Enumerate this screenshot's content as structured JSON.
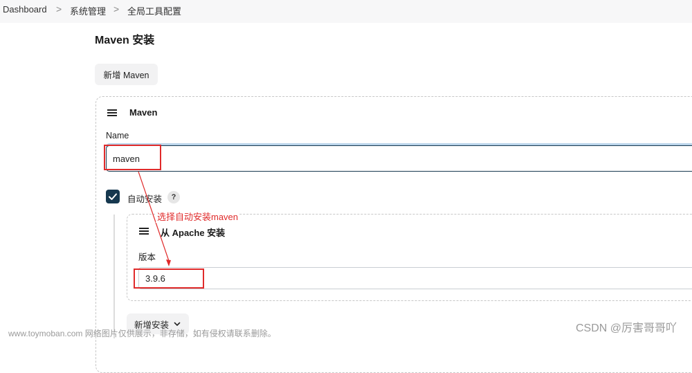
{
  "breadcrumb": {
    "items": [
      "Dashboard",
      "系统管理",
      "全局工具配置"
    ],
    "separator": ">"
  },
  "page_title": "Maven 安装",
  "add_maven_button": "新增 Maven",
  "maven_section": {
    "title": "Maven",
    "name_label": "Name",
    "name_value": "maven"
  },
  "auto_install": {
    "label": "自动安装",
    "checked": true,
    "help": "?"
  },
  "installer": {
    "title": "从 Apache 安装",
    "version_label": "版本",
    "version_value": "3.9.6"
  },
  "add_installer_button": "新增安装",
  "annotation_text": "选择自动安装maven",
  "watermark_left": "www.toymoban.com 网络图片仅供展示，非存储，如有侵权请联系删除。",
  "watermark_right": "CSDN @厉害哥哥吖",
  "colors": {
    "accent": "#16384f",
    "annotation_red": "#e02a2a",
    "focus_ring": "#b9d3ea"
  }
}
